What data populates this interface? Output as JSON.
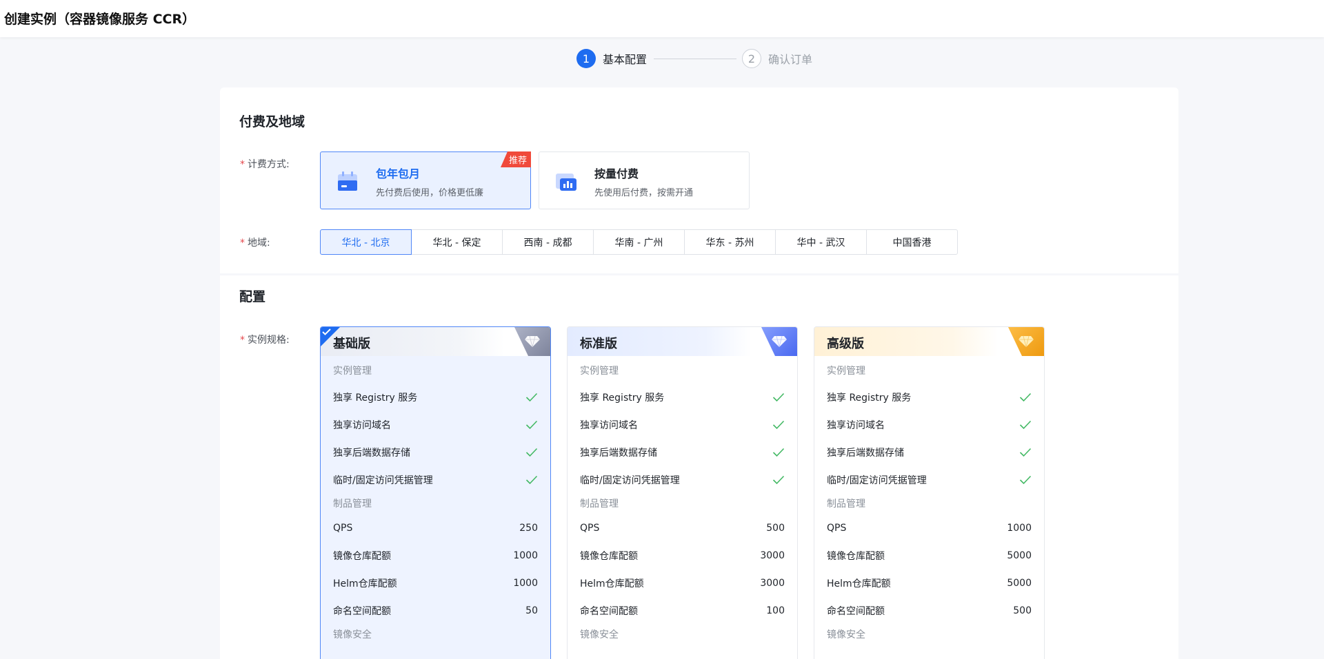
{
  "header": {
    "title": "创建实例（容器镜像服务 CCR）"
  },
  "steps": [
    {
      "number": "1",
      "label": "基本配置"
    },
    {
      "number": "2",
      "label": "确认订单"
    }
  ],
  "billing_section": {
    "title": "付费及地域",
    "billing_label": "计费方式:",
    "options": [
      {
        "title": "包年包月",
        "desc": "先付费后使用，价格更低廉",
        "badge": "推荐"
      },
      {
        "title": "按量付费",
        "desc": "先使用后付费，按需开通"
      }
    ],
    "region_label": "地域:",
    "regions": [
      "华北 - 北京",
      "华北 - 保定",
      "西南 - 成都",
      "华南 - 广州",
      "华东 - 苏州",
      "华中 - 武汉",
      "中国香港"
    ],
    "selected_region": "华北 - 北京"
  },
  "config_section": {
    "title": "配置",
    "spec_label": "实例规格:",
    "group_labels": {
      "instance": "实例管理",
      "artifact": "制品管理",
      "security": "镜像安全"
    },
    "feature_labels": [
      "独享 Registry 服务",
      "独享访问域名",
      "独享后端数据存储",
      "临时/固定访问凭据管理"
    ],
    "quota_labels": [
      "QPS",
      "镜像仓库配额",
      "Helm仓库配额",
      "命名空间配额"
    ],
    "editions": [
      {
        "name": "基础版",
        "quotas": [
          "250",
          "1000",
          "1000",
          "50"
        ],
        "selected": true,
        "color": "#7e849c"
      },
      {
        "name": "标准版",
        "quotas": [
          "500",
          "3000",
          "3000",
          "100"
        ],
        "selected": false,
        "color": "#4a69f0"
      },
      {
        "name": "高级版",
        "quotas": [
          "1000",
          "5000",
          "5000",
          "500"
        ],
        "selected": false,
        "color": "#ee9a10"
      }
    ]
  },
  "colors": {
    "primary": "#1e6cf0",
    "check": "#43b964",
    "required": "#e5484d",
    "badge": "#f04a3a"
  }
}
